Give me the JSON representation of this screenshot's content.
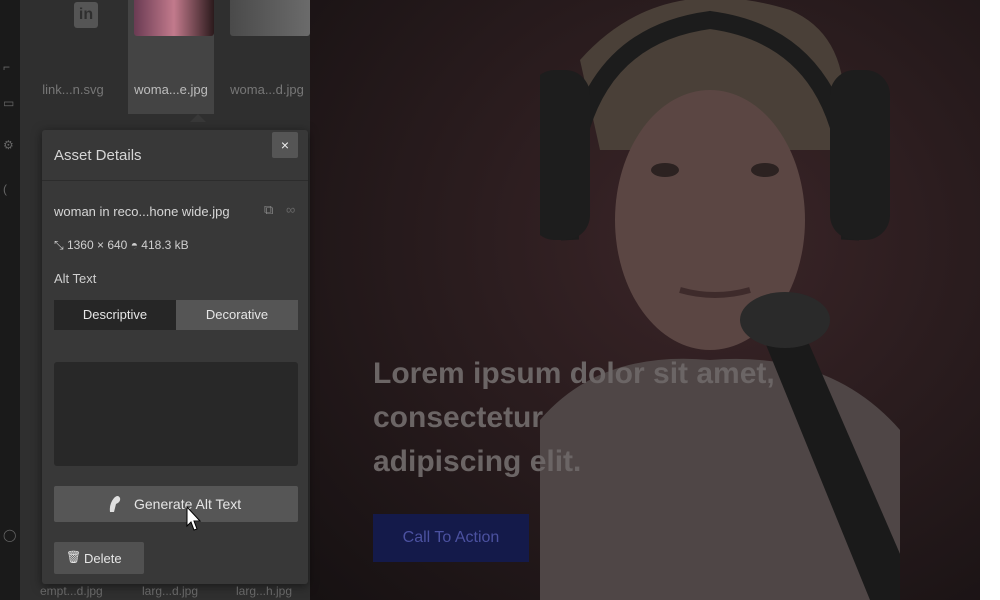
{
  "thumbnails": [
    {
      "caption": "link...n.svg",
      "selected": false
    },
    {
      "caption": "woma...e.jpg",
      "selected": true
    },
    {
      "caption": "woma...d.jpg",
      "selected": false
    }
  ],
  "bottom_captions": [
    "empt...d.jpg",
    "larg...d.jpg",
    "larg...h.jpg"
  ],
  "asset_details": {
    "title": "Asset Details",
    "close_icon": "×",
    "filename": "woman in reco...hone wide.jpg",
    "dimensions": "1360 × 640",
    "file_size": "418.3 kB",
    "alt_text_label": "Alt Text",
    "alt_modes": [
      "Descriptive",
      "Decorative"
    ],
    "alt_text_value": "",
    "generate_label": "Generate Alt Text",
    "delete_label": "Delete"
  },
  "hero": {
    "heading_line1": "Lorem ipsum dolor sit amet,",
    "heading_line2": "consectetur",
    "heading_line3": "adipiscing elit.",
    "cta_label": "Call To Action"
  },
  "colors": {
    "panel": "#2f2f2f",
    "popup": "#383838",
    "cta_bg": "#141a4a",
    "cta_text": "#4b51a0"
  }
}
